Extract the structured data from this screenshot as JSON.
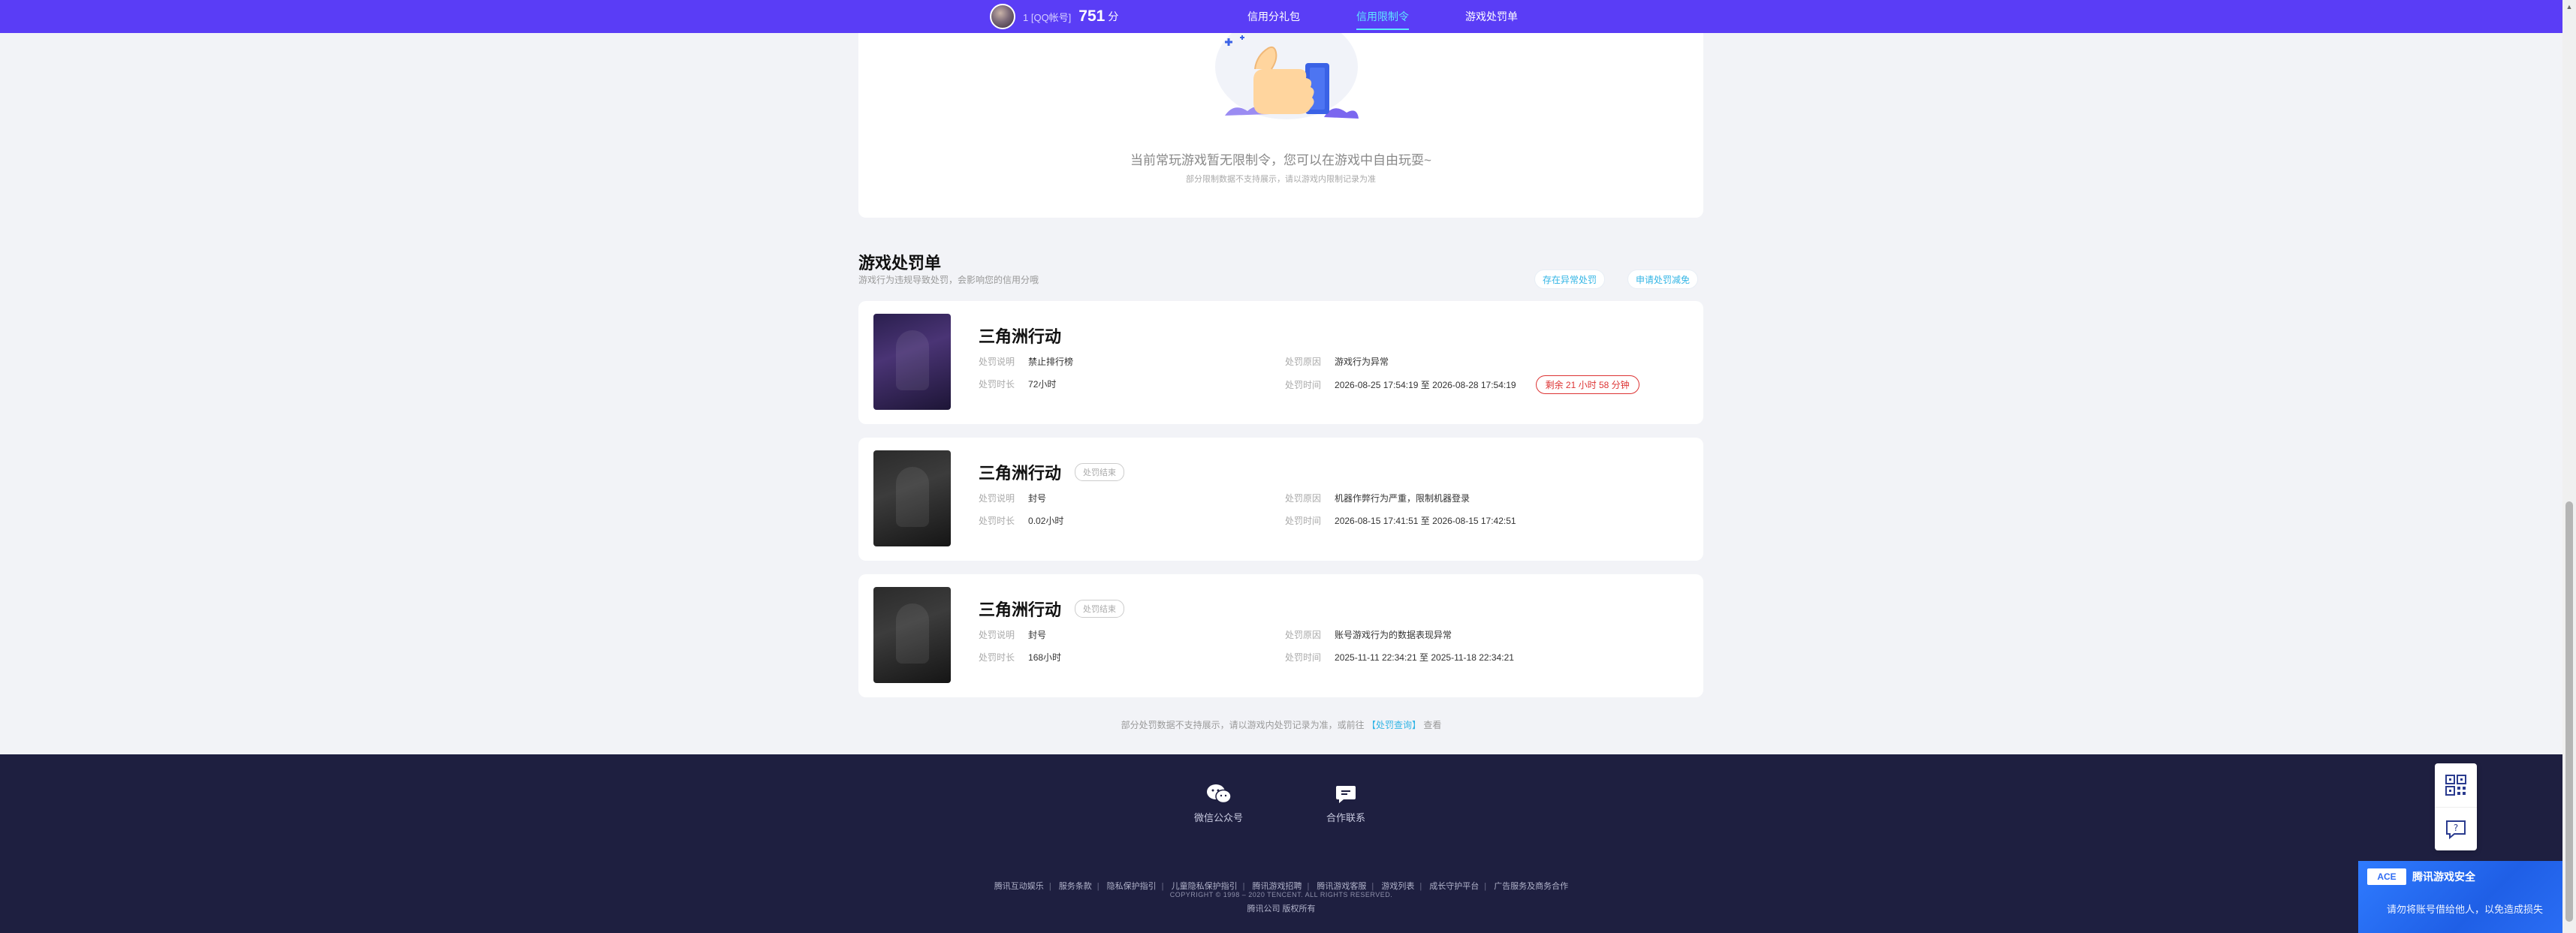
{
  "header": {
    "user_name": "1 [QQ帐号]",
    "score": "751",
    "score_unit": "分",
    "nav": [
      {
        "label": "信用分礼包",
        "active": false
      },
      {
        "label": "信用限制令",
        "active": true
      },
      {
        "label": "游戏处罚单",
        "active": false
      }
    ]
  },
  "empty_state": {
    "message": "当前常玩游戏暂无限制令，您可以在游戏中自由玩耍~",
    "sub": "部分限制数据不支持展示，请以游戏内限制记录为准"
  },
  "penalty_section": {
    "title": "游戏处罚单",
    "subtitle": "游戏行为违规导致处罚，会影响您的信用分哦",
    "btn_appeal": "存在异常处罚",
    "btn_reduce": "申请处罚减免"
  },
  "labels": {
    "desc": "处罚说明",
    "duration": "处罚时长",
    "reason": "处罚原因",
    "time": "处罚时间",
    "to": "至"
  },
  "penalties": [
    {
      "game": "三角洲行动",
      "tag": "",
      "desc": "禁止排行榜",
      "duration": "72小时",
      "reason": "游戏行为异常",
      "start": "2026-08-25 17:54:19",
      "end": "2026-08-28 17:54:19",
      "remaining": "剩余 21 小时 58 分钟"
    },
    {
      "game": "三角洲行动",
      "tag": "处罚结束",
      "desc": "封号",
      "duration": "0.02小时",
      "reason": "机器作弊行为严重，限制机器登录",
      "start": "2026-08-15 17:41:51",
      "end": "2026-08-15 17:42:51",
      "remaining": ""
    },
    {
      "game": "三角洲行动",
      "tag": "处罚结束",
      "desc": "封号",
      "duration": "168小时",
      "reason": "账号游戏行为的数据表现异常",
      "start": "2025-11-11 22:34:21",
      "end": "2025-11-18 22:34:21",
      "remaining": ""
    }
  ],
  "bottom_note": {
    "prefix": "部分处罚数据不支持展示，请以游戏内处罚记录为准，或前往",
    "link": "【处罚查询】",
    "suffix": "查看"
  },
  "footer": {
    "wechat_label": "微信公众号",
    "contact_label": "合作联系",
    "links": [
      "腾讯互动娱乐",
      "服务条款",
      "隐私保护指引",
      "儿童隐私保护指引",
      "腾讯游戏招聘",
      "腾讯游戏客服",
      "游戏列表",
      "成长守护平台",
      "广告服务及商务合作"
    ],
    "copyright": "COPYRIGHT © 1998 – 2020 TENCENT. ALL RIGHTS RESERVED.",
    "rights": "腾讯公司 版权所有"
  },
  "security_banner": {
    "mark": "ACE",
    "title": "腾讯游戏安全",
    "tip": "请勿将账号借给他人，以免造成损失"
  },
  "icons": {
    "scroll_up": "scroll-up-arrow-icon",
    "qrcode": "qrcode-icon",
    "help": "help-chat-icon",
    "wechat": "wechat-icon",
    "message": "message-icon"
  },
  "colors": {
    "nav_bg": "#5a3df6",
    "nav_active": "#5ee7ff",
    "footer_bg": "#1e1f40",
    "link": "#33b5e5",
    "warning": "#dd3333",
    "banner_blue": "#2f7bff"
  }
}
